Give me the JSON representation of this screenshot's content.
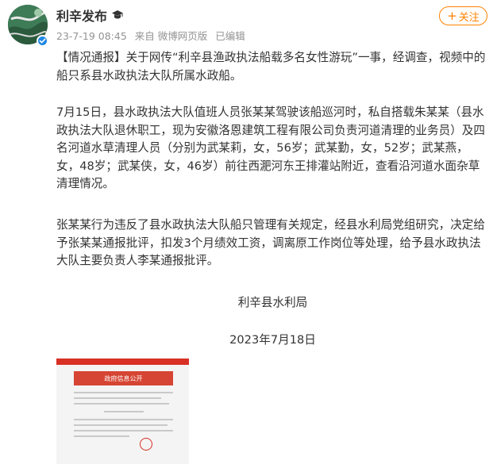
{
  "post": {
    "author": "利辛发布",
    "author_badge_icon": "graduation-cap-icon",
    "date": "23-7-19 08:45",
    "source": "来自 微博网页版",
    "edited": "已编辑",
    "follow_label": "关注",
    "follow_plus": "+",
    "verified_color": "#1e88e5",
    "accent_color": "#ff8200"
  },
  "content": {
    "p1": "【情况通报】关于网传“利辛县渔政执法船载多名女性游玩”一事，经调查，视频中的船只系县水政执法大队所属水政船。",
    "p2": "7月15日，县水政执法大队值班人员张某某驾驶该船巡河时，私自搭载朱某某（县水政执法大队退休职工，现为安徽洛恩建筑工程有限公司负责河道清理的业务员）及四名河道水草清理人员（分别为武某莉，女，56岁；武某勤，女，52岁；武某燕，女，48岁；武某侠，女，46岁）前往西淝河东王排灌站附近，查看沿河道水面杂草清理情况。",
    "p3": "张某某行为违反了县水政执法大队船只管理有关规定，经县水利局党组研究，决定给予张某某通报批评，扣发3个月绩效工资，调离原工作岗位等处理，给予县水政执法大队主要负责人李某通报批评。",
    "signature": "利辛县水利局",
    "sign_date": "2023年7月18日"
  },
  "image": {
    "banner_text": "政府信息公开"
  }
}
